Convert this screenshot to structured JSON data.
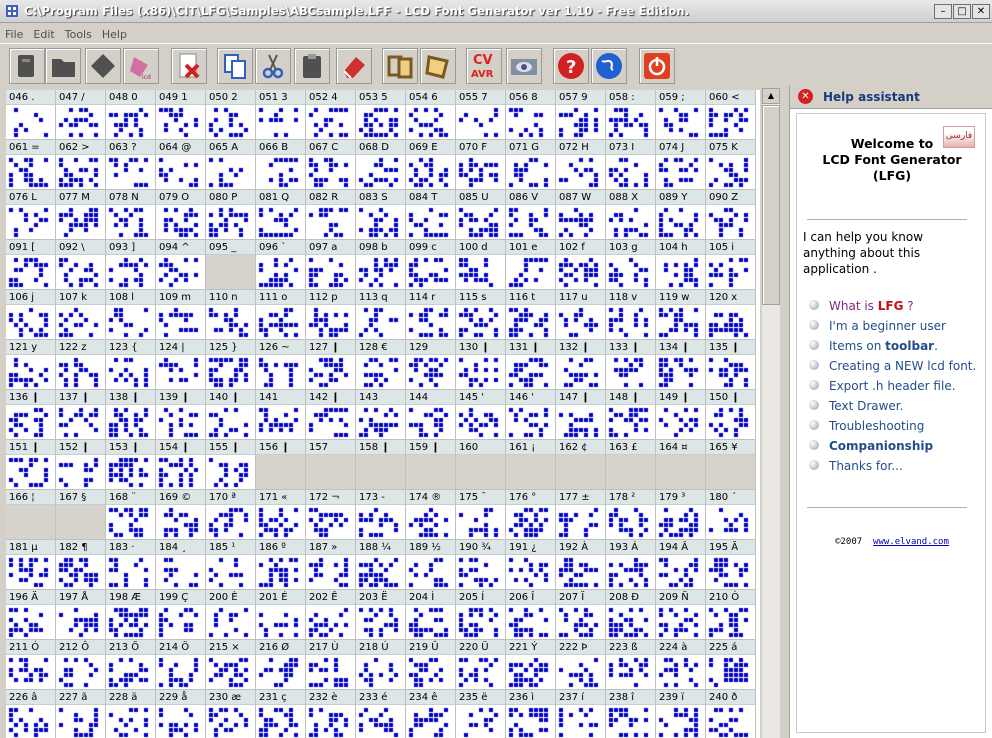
{
  "window": {
    "title": "C:\\Program Files (x86)\\CIT\\LFG\\Samples\\ABCsample.LFF - LCD Font Generator ver 1.10 - Free Edition.",
    "buttons": [
      "minimize",
      "maximize",
      "close"
    ]
  },
  "menu": [
    "File",
    "Edit",
    "Tools",
    "Help"
  ],
  "toolbar": [
    {
      "name": "open-icon",
      "color": "#505050"
    },
    {
      "name": "folder-icon",
      "color": "#505050"
    },
    {
      "name": "erase-font-icon",
      "color": "#505050"
    },
    {
      "name": "print-icon",
      "color": "#d070a0"
    },
    {
      "name": "delete-icon",
      "color": "#d02020"
    },
    {
      "name": "copy-icon",
      "color": "#3060c0"
    },
    {
      "name": "cut-icon",
      "color": "#3060c0"
    },
    {
      "name": "paste-icon",
      "color": "#505050"
    },
    {
      "name": "eraser-icon",
      "color": "#d03030"
    },
    {
      "name": "frames-icon",
      "color": "#7a5a20"
    },
    {
      "name": "frame-icon",
      "color": "#7a5a20"
    },
    {
      "name": "cvavr-icon",
      "color": "#e02020",
      "text": "CV AVR"
    },
    {
      "name": "eye-icon",
      "color": "#505080"
    },
    {
      "name": "help-icon",
      "color": "#d02020"
    },
    {
      "name": "globe-icon",
      "color": "#2060d0"
    },
    {
      "name": "power-icon",
      "color": "#e04020"
    }
  ],
  "grid": {
    "pixel_color": "#0000cc",
    "header_bg": "#dde6e6",
    "rows": [
      [
        {
          "code": "046",
          "ch": "."
        },
        {
          "code": "047",
          "ch": "/"
        },
        {
          "code": "048",
          "ch": "0"
        },
        {
          "code": "049",
          "ch": "1"
        },
        {
          "code": "050",
          "ch": "2"
        },
        {
          "code": "051",
          "ch": "3"
        },
        {
          "code": "052",
          "ch": "4"
        },
        {
          "code": "053",
          "ch": "5"
        },
        {
          "code": "054",
          "ch": "6"
        },
        {
          "code": "055",
          "ch": "7"
        },
        {
          "code": "056",
          "ch": "8"
        },
        {
          "code": "057",
          "ch": "9"
        },
        {
          "code": "058",
          "ch": ":"
        },
        {
          "code": "059",
          "ch": ";"
        },
        {
          "code": "060",
          "ch": "<"
        }
      ],
      [
        {
          "code": "061",
          "ch": "="
        },
        {
          "code": "062",
          "ch": ">"
        },
        {
          "code": "063",
          "ch": "?"
        },
        {
          "code": "064",
          "ch": "@"
        },
        {
          "code": "065",
          "ch": "A"
        },
        {
          "code": "066",
          "ch": "B"
        },
        {
          "code": "067",
          "ch": "C"
        },
        {
          "code": "068",
          "ch": "D"
        },
        {
          "code": "069",
          "ch": "E"
        },
        {
          "code": "070",
          "ch": "F"
        },
        {
          "code": "071",
          "ch": "G"
        },
        {
          "code": "072",
          "ch": "H"
        },
        {
          "code": "073",
          "ch": "I"
        },
        {
          "code": "074",
          "ch": "J"
        },
        {
          "code": "075",
          "ch": "K"
        }
      ],
      [
        {
          "code": "076",
          "ch": "L"
        },
        {
          "code": "077",
          "ch": "M"
        },
        {
          "code": "078",
          "ch": "N"
        },
        {
          "code": "079",
          "ch": "O"
        },
        {
          "code": "080",
          "ch": "P"
        },
        {
          "code": "081",
          "ch": "Q"
        },
        {
          "code": "082",
          "ch": "R"
        },
        {
          "code": "083",
          "ch": "S"
        },
        {
          "code": "084",
          "ch": "T"
        },
        {
          "code": "085",
          "ch": "U"
        },
        {
          "code": "086",
          "ch": "V"
        },
        {
          "code": "087",
          "ch": "W"
        },
        {
          "code": "088",
          "ch": "X"
        },
        {
          "code": "089",
          "ch": "Y"
        },
        {
          "code": "090",
          "ch": "Z"
        }
      ],
      [
        {
          "code": "091",
          "ch": "["
        },
        {
          "code": "092",
          "ch": "\\"
        },
        {
          "code": "093",
          "ch": "]"
        },
        {
          "code": "094",
          "ch": "^"
        },
        {
          "code": "095",
          "ch": "_",
          "empty": true
        },
        {
          "code": "096",
          "ch": "`"
        },
        {
          "code": "097",
          "ch": "a"
        },
        {
          "code": "098",
          "ch": "b"
        },
        {
          "code": "099",
          "ch": "c"
        },
        {
          "code": "100",
          "ch": "d"
        },
        {
          "code": "101",
          "ch": "e"
        },
        {
          "code": "102",
          "ch": "f"
        },
        {
          "code": "103",
          "ch": "g"
        },
        {
          "code": "104",
          "ch": "h"
        },
        {
          "code": "105",
          "ch": "i"
        }
      ],
      [
        {
          "code": "106",
          "ch": "j"
        },
        {
          "code": "107",
          "ch": "k"
        },
        {
          "code": "108",
          "ch": "l"
        },
        {
          "code": "109",
          "ch": "m"
        },
        {
          "code": "110",
          "ch": "n"
        },
        {
          "code": "111",
          "ch": "o"
        },
        {
          "code": "112",
          "ch": "p"
        },
        {
          "code": "113",
          "ch": "q"
        },
        {
          "code": "114",
          "ch": "r"
        },
        {
          "code": "115",
          "ch": "s"
        },
        {
          "code": "116",
          "ch": "t"
        },
        {
          "code": "117",
          "ch": "u"
        },
        {
          "code": "118",
          "ch": "v"
        },
        {
          "code": "119",
          "ch": "w"
        },
        {
          "code": "120",
          "ch": "x"
        }
      ],
      [
        {
          "code": "121",
          "ch": "y"
        },
        {
          "code": "122",
          "ch": "z"
        },
        {
          "code": "123",
          "ch": "{"
        },
        {
          "code": "124",
          "ch": "|"
        },
        {
          "code": "125",
          "ch": "}"
        },
        {
          "code": "126",
          "ch": "~"
        },
        {
          "code": "127",
          "ch": "❙"
        },
        {
          "code": "128",
          "ch": "€"
        },
        {
          "code": "129",
          "ch": ""
        },
        {
          "code": "130",
          "ch": "❙"
        },
        {
          "code": "131",
          "ch": "❙"
        },
        {
          "code": "132",
          "ch": "❙"
        },
        {
          "code": "133",
          "ch": "❙"
        },
        {
          "code": "134",
          "ch": "❙"
        },
        {
          "code": "135",
          "ch": "❙"
        }
      ],
      [
        {
          "code": "136",
          "ch": "❙"
        },
        {
          "code": "137",
          "ch": "❙"
        },
        {
          "code": "138",
          "ch": "❙"
        },
        {
          "code": "139",
          "ch": "❙"
        },
        {
          "code": "140",
          "ch": "❙"
        },
        {
          "code": "141",
          "ch": ""
        },
        {
          "code": "142",
          "ch": "❙"
        },
        {
          "code": "143",
          "ch": ""
        },
        {
          "code": "144",
          "ch": ""
        },
        {
          "code": "145",
          "ch": "'"
        },
        {
          "code": "146",
          "ch": "'"
        },
        {
          "code": "147",
          "ch": "❙"
        },
        {
          "code": "148",
          "ch": "❙"
        },
        {
          "code": "149",
          "ch": "❙"
        },
        {
          "code": "150",
          "ch": "❙"
        }
      ],
      [
        {
          "code": "151",
          "ch": "❙"
        },
        {
          "code": "152",
          "ch": "❙"
        },
        {
          "code": "153",
          "ch": "❙"
        },
        {
          "code": "154",
          "ch": "❙"
        },
        {
          "code": "155",
          "ch": "❙"
        },
        {
          "code": "156",
          "ch": "❙",
          "empty": true
        },
        {
          "code": "157",
          "ch": "",
          "empty": true
        },
        {
          "code": "158",
          "ch": "❙",
          "empty": true
        },
        {
          "code": "159",
          "ch": "❙",
          "empty": true
        },
        {
          "code": "160",
          "ch": "",
          "empty": true
        },
        {
          "code": "161",
          "ch": "¡",
          "empty": true
        },
        {
          "code": "162",
          "ch": "¢",
          "empty": true
        },
        {
          "code": "163",
          "ch": "£",
          "empty": true
        },
        {
          "code": "164",
          "ch": "¤",
          "empty": true
        },
        {
          "code": "165",
          "ch": "¥",
          "empty": true
        }
      ],
      [
        {
          "code": "166",
          "ch": "¦",
          "empty": true
        },
        {
          "code": "167",
          "ch": "§",
          "empty": true
        },
        {
          "code": "168",
          "ch": "¨"
        },
        {
          "code": "169",
          "ch": "©"
        },
        {
          "code": "170",
          "ch": "ª"
        },
        {
          "code": "171",
          "ch": "«"
        },
        {
          "code": "172",
          "ch": "¬"
        },
        {
          "code": "173",
          "ch": "-"
        },
        {
          "code": "174",
          "ch": "®"
        },
        {
          "code": "175",
          "ch": "¯"
        },
        {
          "code": "176",
          "ch": "°"
        },
        {
          "code": "177",
          "ch": "±"
        },
        {
          "code": "178",
          "ch": "²"
        },
        {
          "code": "179",
          "ch": "³"
        },
        {
          "code": "180",
          "ch": "´"
        }
      ],
      [
        {
          "code": "181",
          "ch": "µ"
        },
        {
          "code": "182",
          "ch": "¶"
        },
        {
          "code": "183",
          "ch": "·"
        },
        {
          "code": "184",
          "ch": "¸"
        },
        {
          "code": "185",
          "ch": "¹"
        },
        {
          "code": "186",
          "ch": "º"
        },
        {
          "code": "187",
          "ch": "»"
        },
        {
          "code": "188",
          "ch": "¼"
        },
        {
          "code": "189",
          "ch": "½"
        },
        {
          "code": "190",
          "ch": "¾"
        },
        {
          "code": "191",
          "ch": "¿"
        },
        {
          "code": "192",
          "ch": "À"
        },
        {
          "code": "193",
          "ch": "Á"
        },
        {
          "code": "194",
          "ch": "Â"
        },
        {
          "code": "195",
          "ch": "Ã"
        }
      ],
      [
        {
          "code": "196",
          "ch": "Ä"
        },
        {
          "code": "197",
          "ch": "Å"
        },
        {
          "code": "198",
          "ch": "Æ"
        },
        {
          "code": "199",
          "ch": "Ç"
        },
        {
          "code": "200",
          "ch": "È"
        },
        {
          "code": "201",
          "ch": "É"
        },
        {
          "code": "202",
          "ch": "Ê"
        },
        {
          "code": "203",
          "ch": "Ë"
        },
        {
          "code": "204",
          "ch": "Ì"
        },
        {
          "code": "205",
          "ch": "Í"
        },
        {
          "code": "206",
          "ch": "Î"
        },
        {
          "code": "207",
          "ch": "Ï"
        },
        {
          "code": "208",
          "ch": "Ð"
        },
        {
          "code": "209",
          "ch": "Ñ"
        },
        {
          "code": "210",
          "ch": "Ò"
        }
      ],
      [
        {
          "code": "211",
          "ch": "Ó"
        },
        {
          "code": "212",
          "ch": "Ô"
        },
        {
          "code": "213",
          "ch": "Õ"
        },
        {
          "code": "214",
          "ch": "Ö"
        },
        {
          "code": "215",
          "ch": "×"
        },
        {
          "code": "216",
          "ch": "Ø"
        },
        {
          "code": "217",
          "ch": "Ù"
        },
        {
          "code": "218",
          "ch": "Ú"
        },
        {
          "code": "219",
          "ch": "Û"
        },
        {
          "code": "220",
          "ch": "Ü"
        },
        {
          "code": "221",
          "ch": "Ý"
        },
        {
          "code": "222",
          "ch": "Þ"
        },
        {
          "code": "223",
          "ch": "ß"
        },
        {
          "code": "224",
          "ch": "à"
        },
        {
          "code": "225",
          "ch": "á"
        }
      ],
      [
        {
          "code": "226",
          "ch": "â"
        },
        {
          "code": "227",
          "ch": "ã"
        },
        {
          "code": "228",
          "ch": "ä"
        },
        {
          "code": "229",
          "ch": "å"
        },
        {
          "code": "230",
          "ch": "æ"
        },
        {
          "code": "231",
          "ch": "ç"
        },
        {
          "code": "232",
          "ch": "è"
        },
        {
          "code": "233",
          "ch": "é"
        },
        {
          "code": "234",
          "ch": "ê"
        },
        {
          "code": "235",
          "ch": "ë"
        },
        {
          "code": "236",
          "ch": "ì"
        },
        {
          "code": "237",
          "ch": "í"
        },
        {
          "code": "238",
          "ch": "î"
        },
        {
          "code": "239",
          "ch": "ï"
        },
        {
          "code": "240",
          "ch": "ð"
        }
      ]
    ]
  },
  "help": {
    "title": "Help assistant",
    "farsi_label": "فارسی",
    "welcome": [
      "Welcome to",
      "LCD Font Generator",
      "(LFG)"
    ],
    "intro": "I can help you know anything about this application .",
    "links": [
      {
        "pre": "What is ",
        "bold": "LFG",
        "post": " ?",
        "visited": true
      },
      {
        "pre": "I'm a beginner user",
        "bold": "",
        "post": ""
      },
      {
        "pre": "Items on ",
        "bold": "toolbar",
        "post": "."
      },
      {
        "pre": "Creating a NEW lcd font.",
        "bold": "",
        "post": ""
      },
      {
        "pre": "Export .h header file.",
        "bold": "",
        "post": ""
      },
      {
        "pre": "Text Drawer.",
        "bold": "",
        "post": ""
      },
      {
        "pre": "Troubleshooting",
        "bold": "",
        "post": ""
      },
      {
        "pre": "",
        "bold": "Companionship",
        "post": ""
      },
      {
        "pre": "Thanks for...",
        "bold": "",
        "post": ""
      }
    ],
    "copyright": "©2007",
    "site": "www.elvand.com"
  }
}
